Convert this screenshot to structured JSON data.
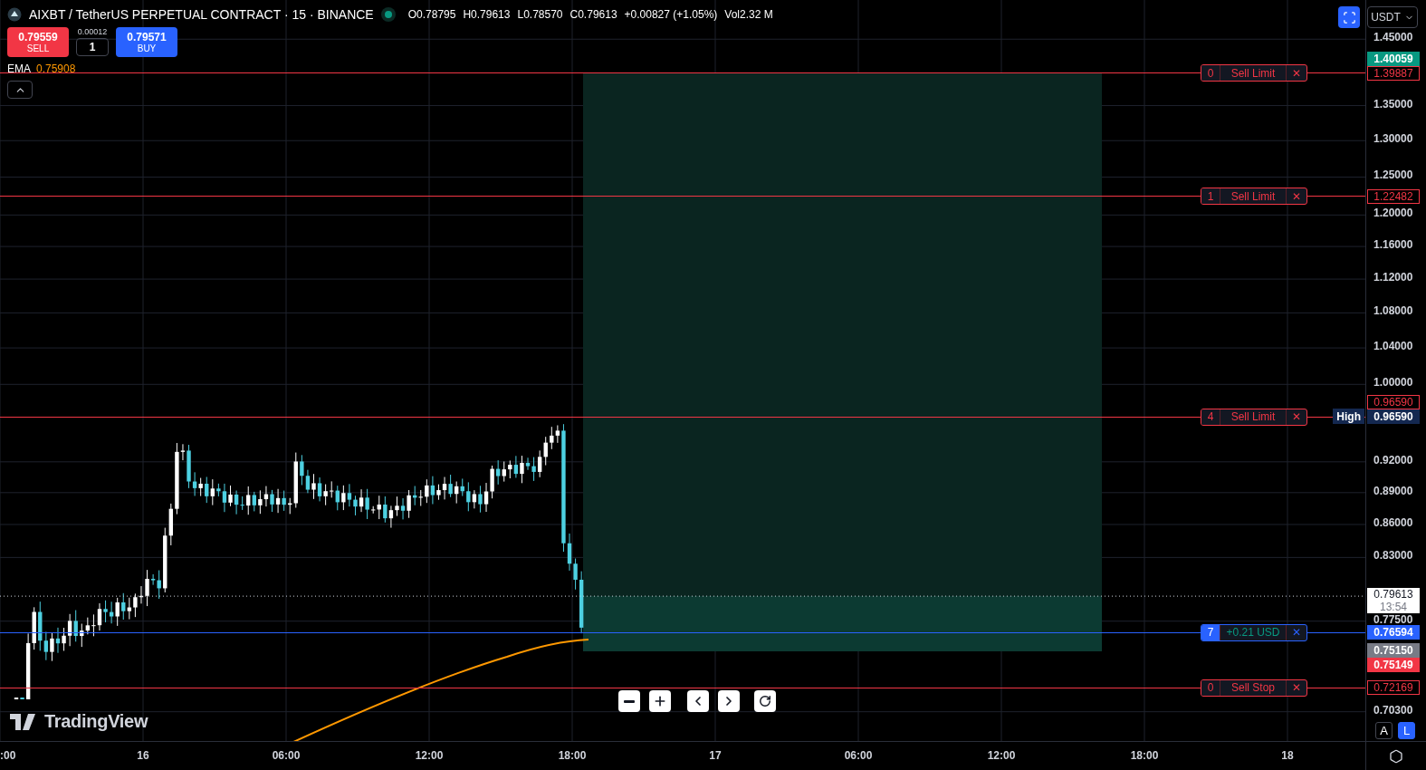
{
  "header": {
    "title": "AIXBT / TetherUS PERPETUAL CONTRACT · 15 · BINANCE",
    "market_open": true,
    "ohlc": [
      "O0.78795",
      "H0.79613",
      "L0.78570",
      "C0.79613",
      "+0.00827 (+1.05%)",
      "Vol2.32 M"
    ]
  },
  "trade": {
    "sell_price": "0.79559",
    "sell_label": "SELL",
    "spread": "0.00012",
    "quantity": "1",
    "buy_price": "0.79571",
    "buy_label": "BUY"
  },
  "indicator": {
    "name": "EMA",
    "value": "0.75908"
  },
  "currency": "USDT",
  "price_axis": {
    "ticks": [
      "1.45000",
      "1.35000",
      "1.30000",
      "1.25000",
      "1.20000",
      "1.16000",
      "1.12000",
      "1.08000",
      "1.04000",
      "1.00000",
      "0.92000",
      "0.89000",
      "0.86000",
      "0.83000",
      "0.77500",
      "0.70300"
    ],
    "markers": [
      {
        "kind": "filled",
        "color": "#089981",
        "text": "1.40059"
      },
      {
        "kind": "high",
        "tag": "High",
        "text": "0.96590"
      },
      {
        "kind": "last",
        "text": "0.79613",
        "countdown": "13:54"
      },
      {
        "kind": "filled",
        "color": "#787b86",
        "text": "0.75150"
      },
      {
        "kind": "filled",
        "color": "#f23645",
        "text": "0.75149"
      }
    ]
  },
  "orders": [
    {
      "kind": "sell",
      "quantity": "0",
      "label": "Sell Limit",
      "close": "✕",
      "price": "1.39887"
    },
    {
      "kind": "sell",
      "quantity": "1",
      "label": "Sell Limit",
      "close": "✕",
      "price": "1.22482"
    },
    {
      "kind": "sell",
      "quantity": "4",
      "label": "Sell Limit",
      "close": "✕",
      "price": "0.96590"
    },
    {
      "kind": "position",
      "quantity": "7",
      "label": "+0.21 USD",
      "close": "✕",
      "price": "0.76594"
    },
    {
      "kind": "sell",
      "quantity": "0",
      "label": "Sell Stop",
      "close": "✕",
      "price": "0.72169"
    }
  ],
  "time_axis": {
    "ticks": [
      ":00",
      "16",
      "06:00",
      "12:00",
      "18:00",
      "17",
      "06:00",
      "12:00",
      "18:00",
      "18"
    ]
  },
  "scale_buttons": [
    {
      "label": "A",
      "selected": false
    },
    {
      "label": "L",
      "selected": true
    }
  ],
  "logo": "TradingView"
}
